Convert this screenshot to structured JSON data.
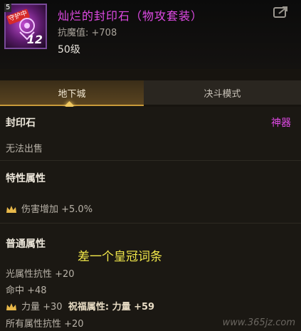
{
  "item": {
    "name": "灿烂的封印石（物攻套装）",
    "stat": "抗魔值: +708",
    "level": "50级",
    "icon_tag": "5",
    "icon_badge": "守护中",
    "icon_number": "12"
  },
  "tabs": [
    {
      "label": "地下城"
    },
    {
      "label": "决斗模式"
    }
  ],
  "type": {
    "label": "封印石",
    "rarity": "神器"
  },
  "trade": "无法出售",
  "special": {
    "title": "特性属性",
    "lines": [
      "伤害增加 +5.0%"
    ]
  },
  "normal": {
    "title": "普通属性",
    "lines": [
      "光属性抗性 +20",
      "命中 +48",
      "力量 +30",
      "祝福属性: 力量 +59",
      "所有属性抗性 +20"
    ]
  },
  "annotation": "差一个皇冠词条",
  "watermark": "www.365jz.com",
  "colors": {
    "name": "#e04ae6",
    "tab_active": "#5a4420",
    "annotation": "#f2e84a"
  }
}
